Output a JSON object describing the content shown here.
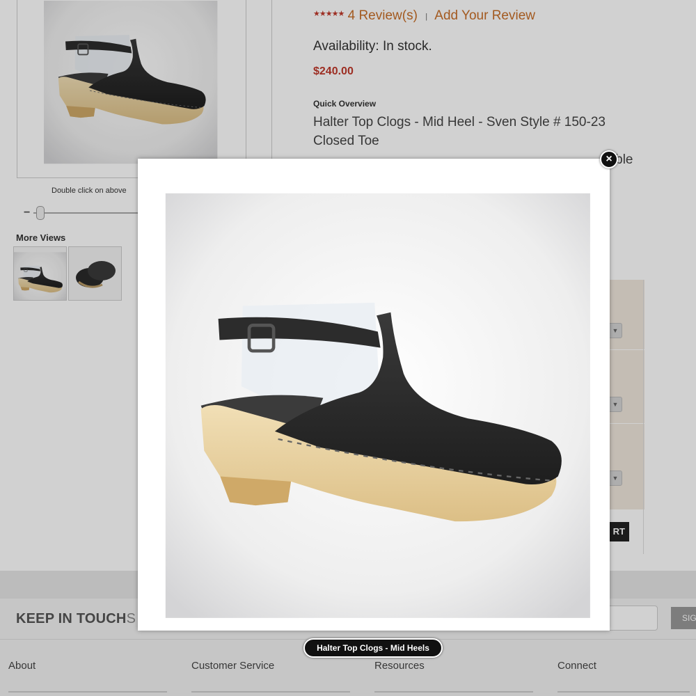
{
  "product": {
    "rating_stars": "★★★★★",
    "reviews_link": "4 Review(s)",
    "separator": "|",
    "add_review_link": "Add Your Review",
    "availability": "Availability: In stock.",
    "price": "$240.00",
    "quick_overview_label": "Quick Overview",
    "overview_line_1": "Halter Top Clogs - Mid Heel - Sven Style # 150-23",
    "overview_line_2": "Closed Toe",
    "overview_line_3_visible_end": "dable"
  },
  "gallery": {
    "zoom_hint": "Double click on above",
    "zoom_minus": "−",
    "more_views_label": "More Views"
  },
  "cart": {
    "button_label_partial": "RT"
  },
  "footer": {
    "keep_in_touch": "KEEP IN TOUCH",
    "keep_in_touch_tail": "S",
    "signup_partial": "SIG",
    "columns": [
      "About",
      "Customer Service",
      "Resources",
      "Connect"
    ]
  },
  "lightbox": {
    "close_symbol": "×",
    "caption": "Halter Top Clogs - Mid Heels"
  },
  "colors": {
    "price_red": "#c0392b",
    "link_orange": "#c76e28",
    "options_panel_beige": "#efe7dc"
  }
}
